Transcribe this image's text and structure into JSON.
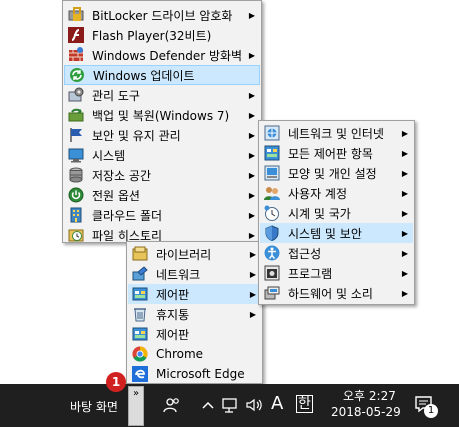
{
  "main_menu": {
    "items": [
      {
        "label": "BitLocker 드라이브 암호화",
        "icon": "bitlocker-icon",
        "has_submenu": true
      },
      {
        "label": "Flash Player(32비트)",
        "icon": "flash-player-icon",
        "has_submenu": false
      },
      {
        "label": "Windows Defender 방화벽",
        "icon": "firewall-icon",
        "has_submenu": true
      },
      {
        "label": "Windows 업데이트",
        "icon": "windows-update-icon",
        "has_submenu": false,
        "highlighted": true
      },
      {
        "label": "관리 도구",
        "icon": "admin-tools-icon",
        "has_submenu": true
      },
      {
        "label": "백업 및 복원(Windows 7)",
        "icon": "backup-restore-icon",
        "has_submenu": true
      },
      {
        "label": "보안 및 유지 관리",
        "icon": "security-maintenance-icon",
        "has_submenu": true
      },
      {
        "label": "시스템",
        "icon": "system-icon",
        "has_submenu": true
      },
      {
        "label": "저장소 공간",
        "icon": "storage-spaces-icon",
        "has_submenu": true
      },
      {
        "label": "전원 옵션",
        "icon": "power-options-icon",
        "has_submenu": true
      },
      {
        "label": "클라우드 폴더",
        "icon": "work-folders-icon",
        "has_submenu": true
      },
      {
        "label": "파일 히스토리",
        "icon": "file-history-icon",
        "has_submenu": true
      }
    ]
  },
  "control_panel_menu": {
    "items": [
      {
        "label": "네트워크 및 인터넷",
        "icon": "network-internet-icon"
      },
      {
        "label": "모든 제어판 항목",
        "icon": "all-control-panel-icon"
      },
      {
        "label": "모양 및 개인 설정",
        "icon": "appearance-icon"
      },
      {
        "label": "사용자 계정",
        "icon": "user-accounts-icon"
      },
      {
        "label": "시계 및 국가",
        "icon": "clock-region-icon"
      },
      {
        "label": "시스템 및 보안",
        "icon": "system-security-icon",
        "highlighted": true
      },
      {
        "label": "접근성",
        "icon": "ease-of-access-icon"
      },
      {
        "label": "프로그램",
        "icon": "programs-icon"
      },
      {
        "label": "하드웨어 및 소리",
        "icon": "hardware-sound-icon"
      }
    ]
  },
  "toolbar_menu": {
    "items": [
      {
        "label": "라이브러리",
        "icon": "libraries-icon",
        "has_submenu": true
      },
      {
        "label": "네트워크",
        "icon": "network-icon",
        "has_submenu": true
      },
      {
        "label": "제어판",
        "icon": "control-panel-icon",
        "has_submenu": true,
        "highlighted": true
      },
      {
        "label": "휴지통",
        "icon": "recycle-bin-icon",
        "has_submenu": true
      },
      {
        "label": "제어판",
        "icon": "control-panel-icon",
        "has_submenu": false
      },
      {
        "label": "Chrome",
        "icon": "chrome-icon",
        "has_submenu": false
      },
      {
        "label": "Microsoft Edge",
        "icon": "edge-icon",
        "has_submenu": false
      }
    ]
  },
  "taskbar": {
    "desktop_label": "바탕 화면",
    "chevron": "»",
    "badge_number": "1",
    "ime_letter": "A",
    "ime_hangul": "한",
    "time": "오후 2:27",
    "date": "2018-05-29",
    "notification_count": "1"
  },
  "colors": {
    "menu_bg": "#f2f2f2",
    "highlight": "#cce8ff",
    "taskbar_bg": "#1f1f1f",
    "badge": "#d0201f"
  }
}
